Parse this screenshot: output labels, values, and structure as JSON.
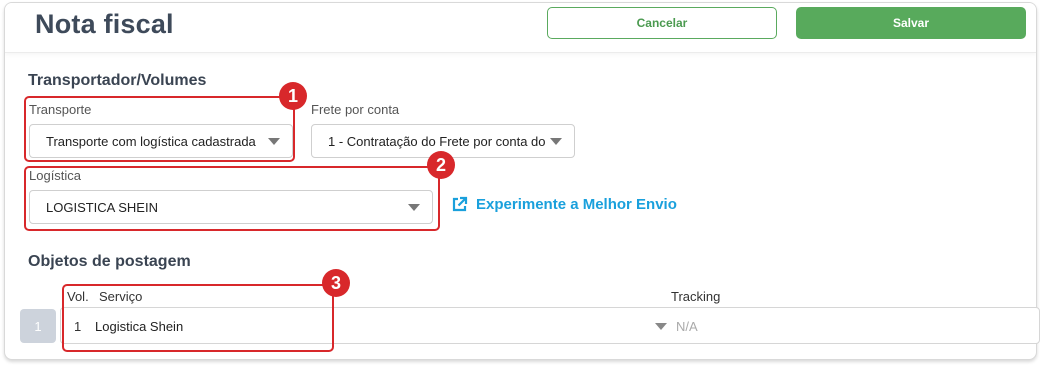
{
  "header": {
    "title": "Nota fiscal",
    "cancel_label": "Cancelar",
    "save_label": "Salvar"
  },
  "transport_section": {
    "title": "Transportador/Volumes",
    "transporte": {
      "label": "Transporte",
      "value": "Transporte com logística cadastrada"
    },
    "frete": {
      "label": "Frete por conta",
      "value": "1 - Contratação do Frete por conta do"
    },
    "logistica": {
      "label": "Logística",
      "value": "LOGISTICA SHEIN"
    },
    "melhor_envio_link": "Experimente a Melhor Envio"
  },
  "objects_section": {
    "title": "Objetos de postagem",
    "columns": {
      "vol": "Vol.",
      "servico": "Serviço",
      "tracking": "Tracking"
    },
    "rows": [
      {
        "index": "1",
        "vol": "1",
        "servico": "Logistica Shein",
        "tracking": "N/A"
      }
    ]
  },
  "annotations": [
    "1",
    "2",
    "3"
  ],
  "colors": {
    "accent_green": "#58aa5c",
    "highlight_red": "#d8282b",
    "link_blue": "#1aa0dc"
  }
}
